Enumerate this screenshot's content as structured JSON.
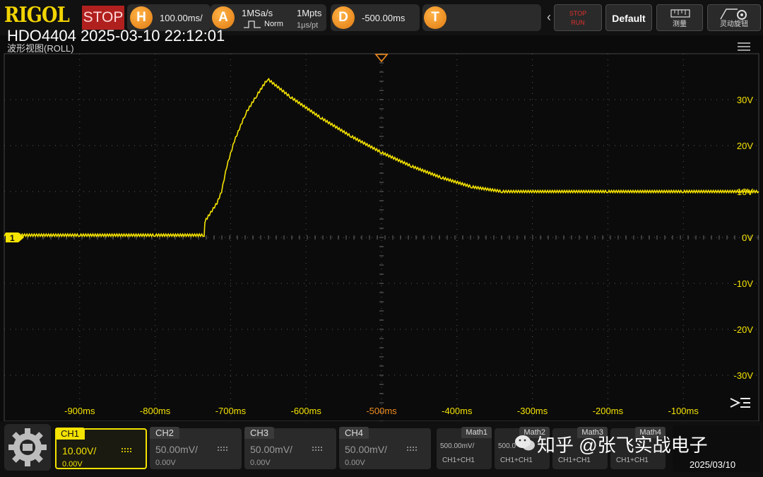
{
  "topbar": {
    "brand": "RIGOL",
    "acq_state": "STOP",
    "h_label": "H",
    "timebase": "100.00ms/",
    "a_label": "A",
    "sample_rate": "1MSa/s",
    "trigger_mode": "Norm",
    "mem_depth": "1Mpts",
    "time_per_pt": "1μs/pt",
    "d_label": "D",
    "delay": "-500.00ms",
    "t_label": "T",
    "run_stop_top": "STOP",
    "run_stop_bottom": "RUN",
    "default_label": "Default",
    "measure_label": "测量",
    "dyn_label": "灵动旋钮"
  },
  "header": {
    "scope_id": "HDO4404 2025-03-10 22:12:01",
    "view_mode": "波形视图(ROLL)"
  },
  "chart_data": {
    "type": "line",
    "xlabel": "",
    "ylabel": "",
    "x_ticks": [
      "-900ms",
      "-800ms",
      "-700ms",
      "-600ms",
      "-500ms",
      "-400ms",
      "-300ms",
      "-200ms",
      "-100ms"
    ],
    "x_tick_values": [
      -900,
      -800,
      -700,
      -600,
      -500,
      -400,
      -300,
      -200,
      -100
    ],
    "y_ticks": [
      "30V",
      "20V",
      "10V",
      "0V",
      "-10V",
      "-20V",
      "-30V"
    ],
    "y_tick_values": [
      30,
      20,
      10,
      0,
      -10,
      -20,
      -30
    ],
    "xlim": [
      -1000,
      0
    ],
    "ylim": [
      -40,
      40
    ],
    "grid": true,
    "trigger_position_ms": -500,
    "channel_marker": "1",
    "series": [
      {
        "color": "#f5e300",
        "x": [
          -1000,
          -900,
          -800,
          -735,
          -734,
          -728,
          -718,
          -712,
          -705,
          -695,
          -680,
          -665,
          -651,
          -620,
          -580,
          -540,
          -500,
          -460,
          -420,
          -380,
          -340,
          -330,
          -320,
          -200,
          -100,
          0
        ],
        "y": [
          0.5,
          0.5,
          0.5,
          0.5,
          3.5,
          5,
          7.5,
          10,
          15.5,
          21,
          27,
          31,
          34.5,
          30.5,
          26,
          22,
          18.5,
          15.5,
          13,
          11,
          10,
          10,
          10,
          10,
          10,
          10
        ]
      }
    ]
  },
  "channels": [
    {
      "name": "CH1",
      "scale": "10.00V/",
      "offset": "0.00V",
      "active": true
    },
    {
      "name": "CH2",
      "scale": "50.00mV/",
      "offset": "0.00V",
      "active": false
    },
    {
      "name": "CH3",
      "scale": "50.00mV/",
      "offset": "0.00V",
      "active": false
    },
    {
      "name": "CH4",
      "scale": "50.00mV/",
      "offset": "0.00V",
      "active": false
    }
  ],
  "maths": [
    {
      "name": "Math1",
      "scale": "500.00mV/",
      "source": "CH1+CH1"
    },
    {
      "name": "Math2",
      "scale": "500.0",
      "source": "CH1+CH1"
    },
    {
      "name": "Math3",
      "scale": "",
      "source": "CH1+CH1"
    },
    {
      "name": "Math4",
      "scale": "",
      "source": "CH1+CH1"
    }
  ],
  "status": {
    "date": "2025/03/10"
  },
  "watermark": {
    "text": "知乎 @张飞实战电子"
  },
  "colors": {
    "ch1": "#f5e300",
    "stop": "#b0201e",
    "accent": "#f08c1c",
    "grid": "#5a5a5a"
  }
}
